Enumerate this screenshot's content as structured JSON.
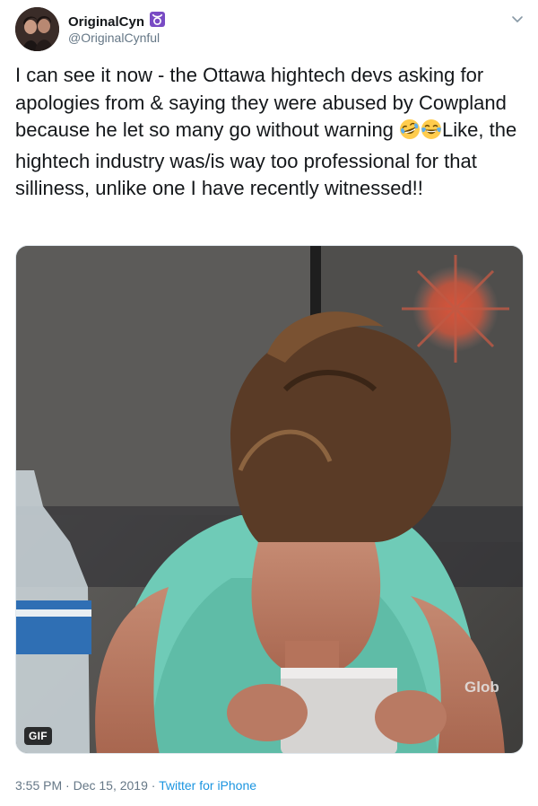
{
  "user": {
    "display_name": "OriginalCyn",
    "zodiac_symbol": "♉",
    "handle": "@OriginalCynful"
  },
  "tweet": {
    "text_before": "I can see it now - the Ottawa hightech devs asking for apologies from & saying they were abused by Cowpland because he let so many go without warning ",
    "emoji_1": "🤣",
    "emoji_2": "😂",
    "text_after": "Like, the hightech industry was/is way too professional for that silliness, unlike one I have recently witnessed!!"
  },
  "media": {
    "badge": "GIF",
    "watermark": "Glob"
  },
  "meta": {
    "time": "3:55 PM",
    "separator": "·",
    "date": "Dec 15, 2019",
    "source": "Twitter for iPhone"
  },
  "icons": {
    "menu": "chevron-down-icon"
  },
  "colors": {
    "link": "#1b95e0",
    "secondary_text": "#657786",
    "zodiac_badge": "#794bc4"
  }
}
